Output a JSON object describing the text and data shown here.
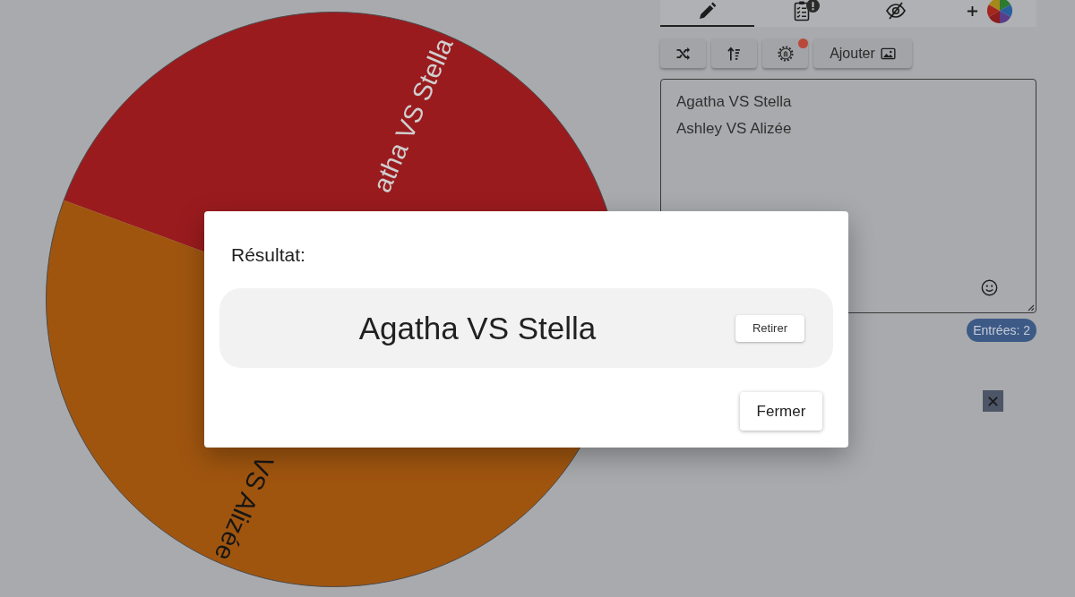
{
  "wheel": {
    "slices": [
      {
        "label": "atha VS Stella",
        "color": "#9a1b1e"
      },
      {
        "label": "VS Alizée",
        "color": "#a0550f"
      }
    ]
  },
  "tabs": [
    {
      "kind": "edit",
      "selected": true,
      "badge": false
    },
    {
      "kind": "results",
      "selected": false,
      "badge": true
    },
    {
      "kind": "hidden",
      "selected": false,
      "badge": false
    },
    {
      "kind": "appearance",
      "selected": false,
      "badge": false
    }
  ],
  "toolbar": [
    {
      "kind": "shuffle",
      "notification": false
    },
    {
      "kind": "sort",
      "notification": false
    },
    {
      "kind": "settings",
      "notification": true
    },
    {
      "kind": "add_image",
      "label": "Ajouter",
      "notification": false
    }
  ],
  "entries": {
    "lines": [
      "Agatha VS Stella",
      "Ashley VS Alizée"
    ],
    "count": "Entrées: 2"
  },
  "dialog": {
    "title": "Résultat:",
    "result": "Agatha VS Stella",
    "remove_button": "Retirer",
    "close_button": "Fermer"
  }
}
